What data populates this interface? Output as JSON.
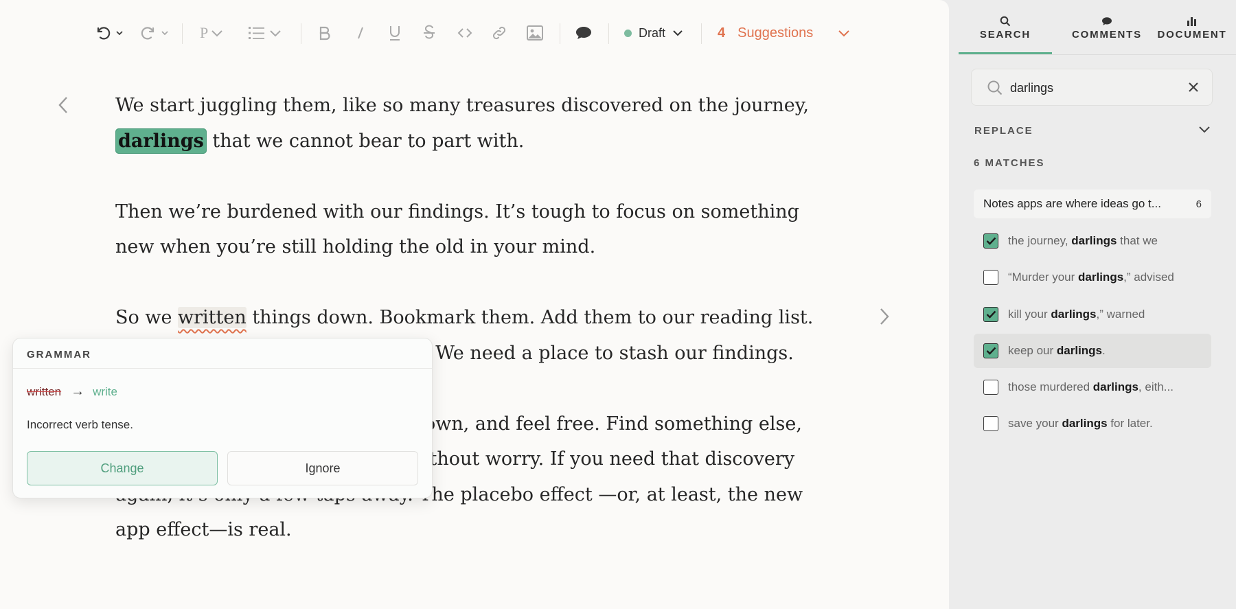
{
  "toolbar": {
    "paragraph_style": "P",
    "status": "Draft",
    "suggestions_count": "4",
    "suggestions_label": "Suggestions"
  },
  "document": {
    "p1_before": "We start juggling them, like so many treasures discovered on the journey,",
    "p1_highlight": "darlings",
    "p1_after": " that we cannot bear to part with.",
    "p2": "Then we’re burdened with our findings. It’s tough to focus on something new when you’re still holding the old in your mind.",
    "p3_before": "So we ",
    "p3_error": "written",
    "p3_after": " things down. Bookmark them. Add them to our reading list. Make lists and check them twice. We need a place to stash our findings.",
    "p4": "We think of something, write it down, and feel free. Find something else, bookmark it, and close the tab without worry. If you need that discovery again, it’s only a few taps away. The placebo effect —or, at least, the new app effect—is real."
  },
  "grammar_popup": {
    "heading": "GRAMMAR",
    "original": "written",
    "arrow": "→",
    "replacement": "write",
    "message": "Incorrect verb tense.",
    "change_label": "Change",
    "ignore_label": "Ignore"
  },
  "sidebar": {
    "tabs": [
      {
        "label": "SEARCH",
        "icon": "search-icon",
        "active": true
      },
      {
        "label": "COMMENTS",
        "icon": "comment-icon",
        "active": false
      },
      {
        "label": "DOCUMENT",
        "icon": "bar-chart-icon",
        "active": false
      }
    ],
    "search_value": "darlings",
    "replace_label": "REPLACE",
    "matches_label": "6 MATCHES",
    "group": {
      "title": "Notes apps are where ideas go t...",
      "count": "6"
    },
    "matches": [
      {
        "pre": "the journey, ",
        "term": "darlings",
        "post": " that we",
        "checked": true
      },
      {
        "pre": "“Murder your ",
        "term": "darlings",
        "post": ",” advised",
        "checked": false
      },
      {
        "pre": "kill your ",
        "term": "darlings",
        "post": ",” warned",
        "checked": true
      },
      {
        "pre": "keep our ",
        "term": "darlings",
        "post": ".",
        "checked": true
      },
      {
        "pre": "those murdered ",
        "term": "darlings",
        "post": ", eith...",
        "checked": false
      },
      {
        "pre": "save your ",
        "term": "darlings",
        "post": " for later.",
        "checked": false
      }
    ]
  },
  "colors": {
    "accent_green": "#5fb08e",
    "suggestion_orange": "#e0734f"
  }
}
